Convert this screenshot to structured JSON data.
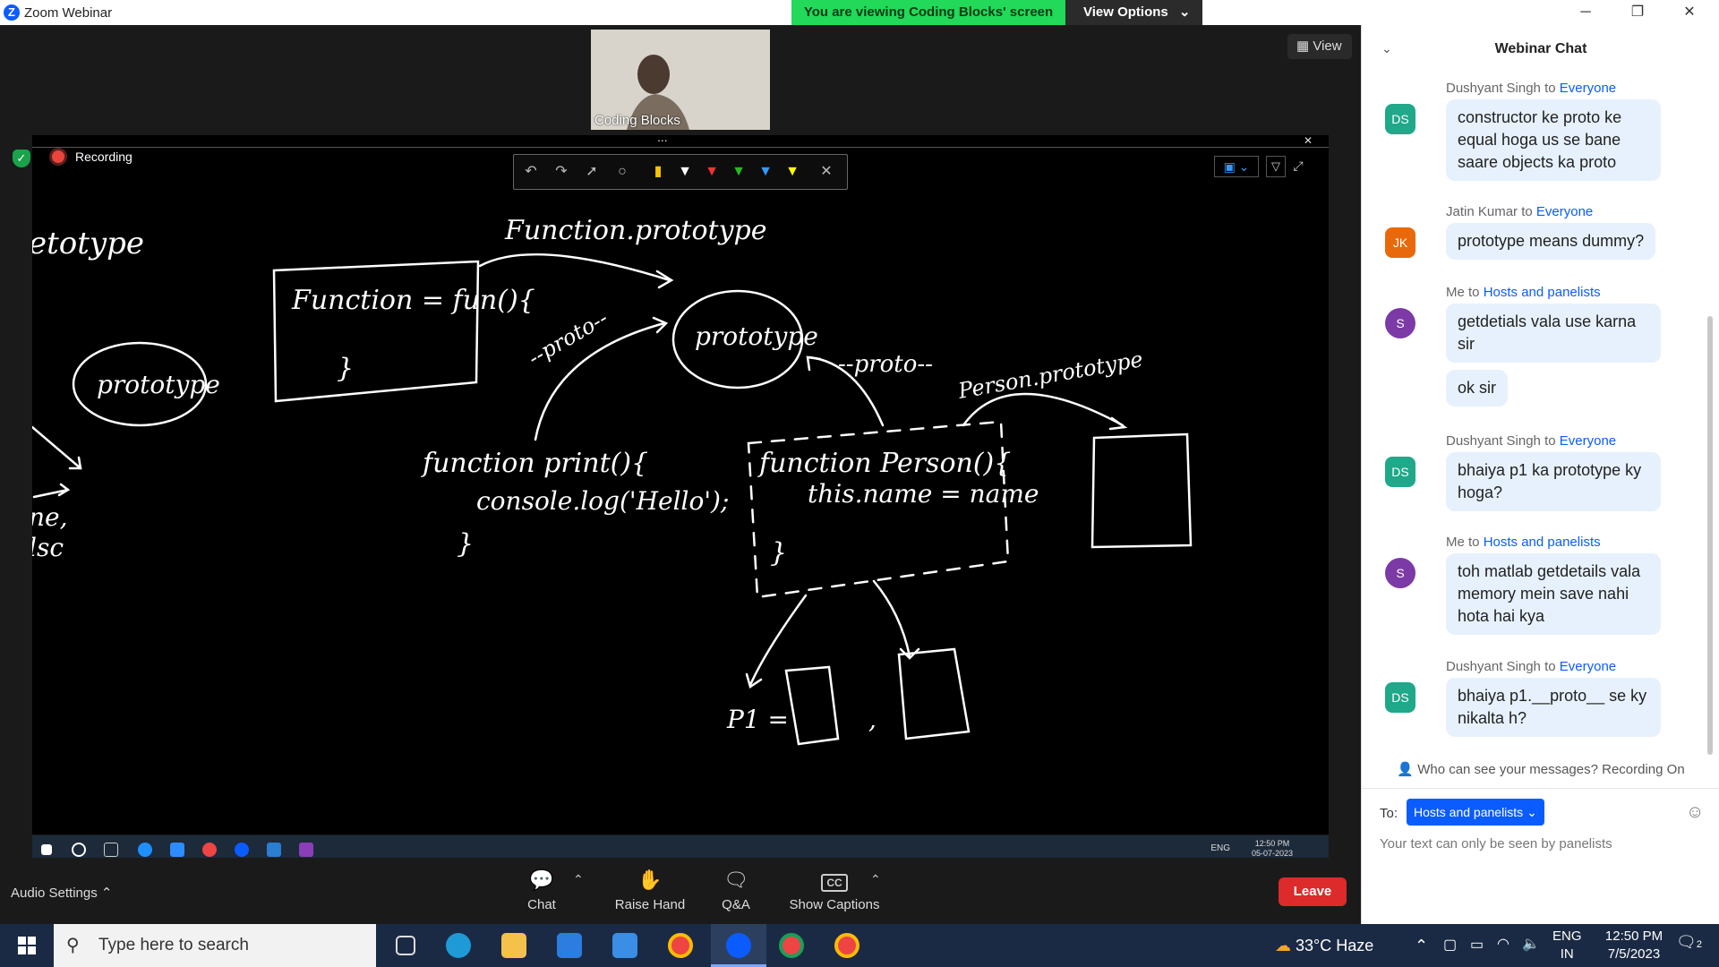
{
  "window": {
    "app_title": "Zoom Webinar",
    "minimize": "─",
    "restore": "❐",
    "close": "✕"
  },
  "share_banner": {
    "viewing_text": "You are viewing Coding Blocks' screen",
    "view_options_label": "View Options"
  },
  "video": {
    "participant_name": "Coding Blocks",
    "view_label": "View"
  },
  "recording": {
    "label": "Recording"
  },
  "share_bar": {
    "dots": "...",
    "close": "✕"
  },
  "annotation_tools": [
    "undo-icon",
    "redo-icon",
    "pointer-icon",
    "search-icon",
    "marker-icon",
    "pen-white-icon",
    "pen-red-icon",
    "pen-green-icon",
    "pen-blue-icon",
    "highlighter-yellow-icon",
    "close-icon"
  ],
  "whiteboard": {
    "texts": [
      "etotype",
      "Function.prototype",
      "Function = fun(){",
      "}",
      "prototype",
      "prototype",
      "--proto--",
      "--proto--",
      "Person.prototype",
      "function print(){",
      "console.log('Hello');",
      "}",
      "function Person(){",
      "this.name = name",
      "}",
      "P1 =",
      ",",
      "ne,",
      "lsc"
    ]
  },
  "inner_taskbar": {
    "time": "12:50 PM",
    "date": "05-07-2023",
    "lang": "ENG"
  },
  "toolbar": {
    "audio_settings": "Audio Settings",
    "chat": "Chat",
    "raise_hand": "Raise Hand",
    "qa": "Q&A",
    "show_captions": "Show Captions",
    "leave": "Leave"
  },
  "chat": {
    "title": "Webinar Chat",
    "messages": [
      {
        "sender": "Dushyant Singh",
        "to": "Everyone",
        "initials": "DS",
        "color": "#1fa889",
        "bubbles": [
          "constructor ke proto ke equal hoga us se bane saare objects ka proto"
        ]
      },
      {
        "sender": "Jatin Kumar",
        "to": "Everyone",
        "initials": "JK",
        "color": "#e8690b",
        "bubbles": [
          "prototype means dummy?"
        ]
      },
      {
        "sender": "Me",
        "to": "Hosts and panelists",
        "initials": "S",
        "color": "#7c3aa6",
        "bubbles": [
          "getdetials vala use karna sir",
          "ok sir"
        ]
      },
      {
        "sender": "Dushyant Singh",
        "to": "Everyone",
        "initials": "DS",
        "color": "#1fa889",
        "bubbles": [
          "bhaiya p1 ka prototype ky hoga?"
        ]
      },
      {
        "sender": "Me",
        "to": "Hosts and panelists",
        "initials": "S",
        "color": "#7c3aa6",
        "bubbles": [
          "toh matlab getdetails vala memory mein save nahi hota hai kya"
        ]
      },
      {
        "sender": "Dushyant Singh",
        "to": "Everyone",
        "initials": "DS",
        "color": "#1fa889",
        "bubbles": [
          "bhaiya p1.__proto__ se ky nikalta h?"
        ]
      }
    ],
    "to_word": " to ",
    "who_can_see": "Who can see your messages? Recording On",
    "to_label": "To:",
    "to_value": "Hosts and panelists",
    "input_hint": "Your text can only be seen by panelists"
  },
  "taskbar": {
    "search_placeholder": "Type here to search",
    "weather": "33°C  Haze",
    "lang_top": "ENG",
    "lang_bottom": "IN",
    "time": "12:50 PM",
    "date": "7/5/2023",
    "notif_count": "2"
  }
}
